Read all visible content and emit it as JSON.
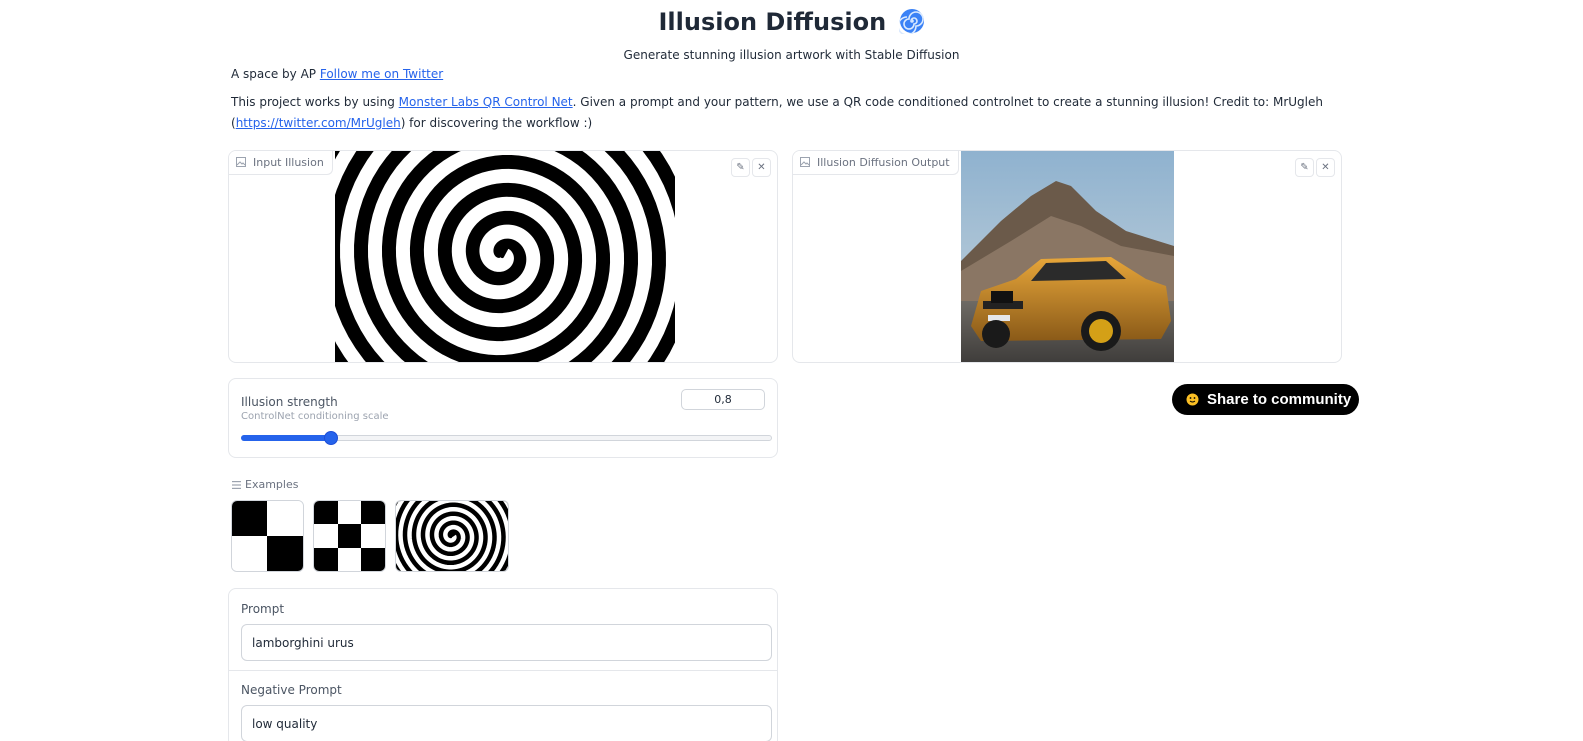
{
  "header": {
    "title": "Illusion Diffusion",
    "subtitle": "Generate stunning illusion artwork with Stable Diffusion"
  },
  "byline": {
    "prefix": "A space by AP ",
    "link": "Follow me on Twitter"
  },
  "description": {
    "part1": "This project works by using ",
    "link1": "Monster Labs QR Control Net",
    "part2": ". Given a prompt and your pattern, we use a QR code conditioned controlnet to create a stunning illusion! Credit to: MrUgleh (",
    "link2": "https://twitter.com/MrUgleh",
    "part3": ") for discovering the workflow :)"
  },
  "input_panel": {
    "label": "Input Illusion"
  },
  "output_panel": {
    "label": "Illusion Diffusion Output"
  },
  "share_button": {
    "label": "Share to community"
  },
  "slider": {
    "label": "Illusion strength",
    "info": "ControlNet conditioning scale",
    "value_text": "0,8",
    "fraction": 0.168
  },
  "examples": {
    "label": "Examples"
  },
  "prompt": {
    "label": "Prompt",
    "value": "lamborghini urus"
  },
  "negative_prompt": {
    "label": "Negative Prompt",
    "value": "low quality"
  },
  "colors": {
    "accent": "#2563eb",
    "border": "#e5e7eb",
    "share_bg": "#000000"
  }
}
